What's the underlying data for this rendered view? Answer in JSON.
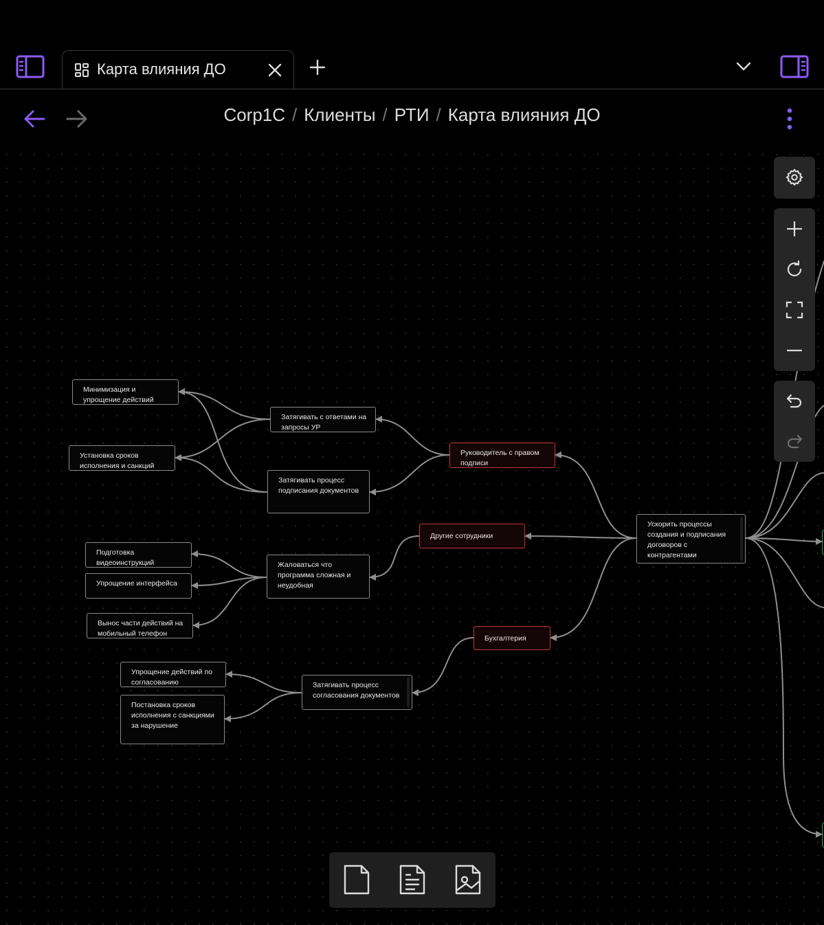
{
  "tabs": [
    {
      "label": "Карта влияния ДО",
      "icon": "dashboard-icon",
      "active": true
    }
  ],
  "breadcrumb": [
    "Corp1C",
    "Клиенты",
    "РТИ",
    "Карта влияния ДО"
  ],
  "colors": {
    "accent": "#8b5cf6",
    "red_node_border": "#c0393b",
    "green_node_border": "#3aa04a",
    "edge": "#8f8f8f"
  },
  "nodes": [
    {
      "id": "n_root",
      "text": "Ускорить процессы создания и подписания договоров с контрагентами"
    },
    {
      "id": "n_head",
      "text": "Руководитель с правом подписи"
    },
    {
      "id": "n_others",
      "text": "Другие сотрудники"
    },
    {
      "id": "n_acc",
      "text": "Бухгалтерия"
    },
    {
      "id": "n_delay_ans",
      "text": "Затягивать с ответами на запросы УР"
    },
    {
      "id": "n_delay_sign",
      "text": "Затягивать процесс подписания документов"
    },
    {
      "id": "n_minimize",
      "text": "Минимизация и упрощение действий"
    },
    {
      "id": "n_deadlines",
      "text": "Установка сроков исполнения и санкций"
    },
    {
      "id": "n_complain",
      "text": "Жаловаться что программа сложная и неудобная"
    },
    {
      "id": "n_video",
      "text": "Подготовка видеоинструкций"
    },
    {
      "id": "n_ui",
      "text": "Упрощение интерфейса"
    },
    {
      "id": "n_mobile",
      "text": "Вынос части действий на мобильный телефон"
    },
    {
      "id": "n_delay_appr",
      "text": "Затягивать процесс согласования документов"
    },
    {
      "id": "n_simplify",
      "text": "Упрощение действий по согласованию"
    },
    {
      "id": "n_deadlines2",
      "text": "Постановка сроков исполнения с санкциями за нарушение"
    }
  ]
}
